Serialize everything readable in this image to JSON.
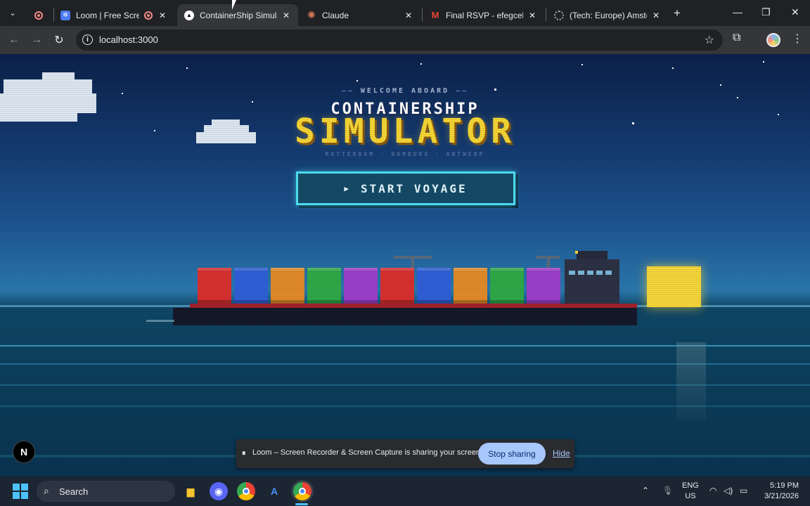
{
  "browser": {
    "tabs": [
      {
        "title": "",
        "icon": "loom-record-icon"
      },
      {
        "title": "Loom | Free Screen",
        "icon": "loom-icon"
      },
      {
        "title": "ContainerShip Simulato",
        "icon": "vercel-icon",
        "active": true
      },
      {
        "title": "Claude",
        "icon": "claude-icon"
      },
      {
        "title": "Final RSVP - efegcek@",
        "icon": "gmail-icon"
      },
      {
        "title": "(Tech: Europe) Amsterd",
        "icon": "loading-icon"
      }
    ],
    "url": "localhost:3000"
  },
  "page": {
    "welcome": "WELCOME ABOARD",
    "title_top": "CONTAINERSHIP",
    "title_main": "SIMULATOR",
    "ports": "ROTTERDAM · HAMBURG · ANTWERP",
    "start_button": "START VOYAGE",
    "container_colors": [
      "#d6302f",
      "#2f5fd6",
      "#e08a2a",
      "#2fa848",
      "#9a3fc8",
      "#d6302f",
      "#2f5fd6",
      "#e08a2a",
      "#2fa848",
      "#9a3fc8"
    ]
  },
  "next_badge": "N",
  "share_bar": {
    "message": "Loom – Screen Recorder & Screen Capture is sharing your screen.",
    "stop_label": "Stop sharing",
    "hide_label": "Hide"
  },
  "taskbar": {
    "search_label": "Search",
    "lang_top": "ENG",
    "lang_bottom": "US",
    "time": "5:19 PM",
    "date": "3/21/2026"
  }
}
